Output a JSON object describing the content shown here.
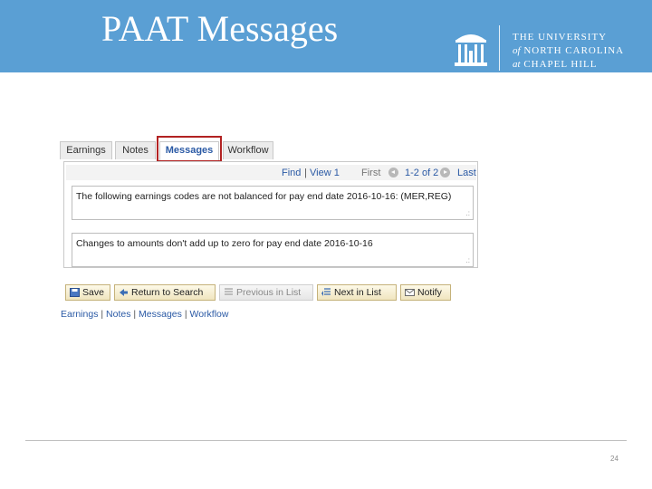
{
  "slide": {
    "title": "PAAT Messages",
    "page_number": "24"
  },
  "logo": {
    "line1": "THE UNIVERSITY",
    "line2_prefix": "of",
    "line2": "NORTH CAROLINA",
    "line3_prefix": "at",
    "line3": "CHAPEL HILL"
  },
  "tabs": [
    {
      "label": "Earnings"
    },
    {
      "label": "Notes"
    },
    {
      "label": "Messages",
      "active": true
    },
    {
      "label": "Workflow"
    }
  ],
  "grid_nav": {
    "find": "Find",
    "sep": "|",
    "view": "View 1",
    "first": "First",
    "range": "1-2 of 2",
    "last": "Last"
  },
  "messages": [
    "The following earnings codes are not balanced for pay end date 2016-10-16: (MER,REG)",
    "Changes to amounts don't add up to zero for pay end date 2016-10-16"
  ],
  "resize_grip": ".:",
  "buttons": {
    "save": "Save",
    "return_to_search": "Return to Search",
    "previous_in_list": "Previous in List",
    "next_in_list": "Next in List",
    "notify": "Notify"
  },
  "footer_links": {
    "earnings": "Earnings",
    "notes": "Notes",
    "messages": "Messages",
    "workflow": "Workflow",
    "sep": "|"
  },
  "colors": {
    "header_bg": "#5a9fd4",
    "link": "#2b5aa5",
    "highlight": "#b22222"
  }
}
